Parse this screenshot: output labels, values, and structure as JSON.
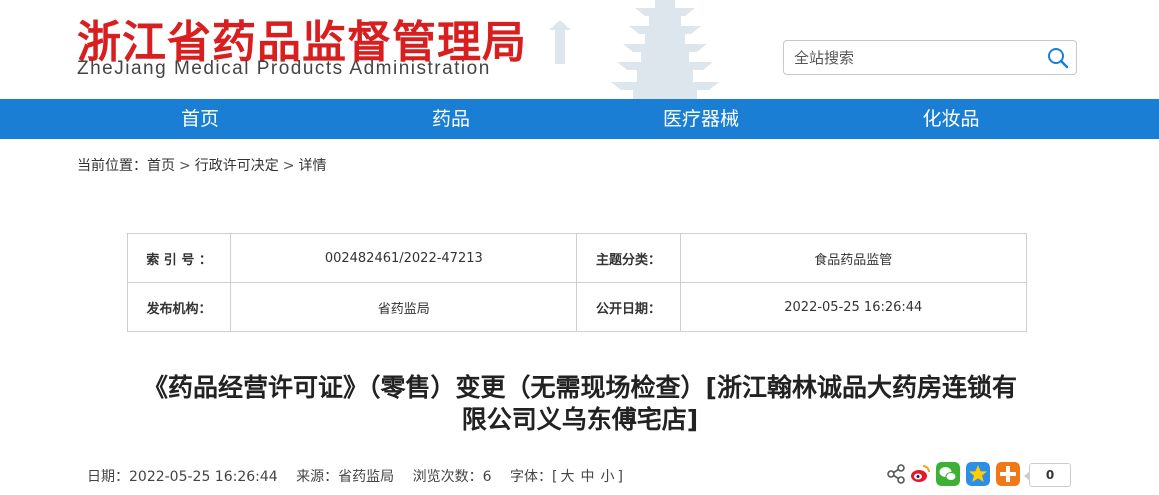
{
  "header": {
    "logo_cn": "浙江省药品监督管理局",
    "logo_en": "ZheJiang Medical Products Administration",
    "search": {
      "placeholder": "全站搜索",
      "icon": "search-icon"
    }
  },
  "nav": {
    "items": [
      {
        "label": "首页"
      },
      {
        "label": "药品"
      },
      {
        "label": "医疗器械"
      },
      {
        "label": "化妆品"
      }
    ],
    "color": "#1a7fd4"
  },
  "breadcrumb": {
    "prefix": "当前位置：",
    "items": [
      "首页",
      "行政许可决定",
      "详情"
    ],
    "separator": ">"
  },
  "info": {
    "index_label": "索 引 号 ：",
    "index_value": "002482461/2022-47213",
    "category_label": "主题分类：",
    "category_value": "食品药品监管",
    "publisher_label": "发布机构：",
    "publisher_value": "省药监局",
    "date_label": "公开日期：",
    "date_value": "2022-05-25 16:26:44"
  },
  "article": {
    "title_line1": "《药品经营许可证》（零售）变更（无需现场检查）[浙江翰林诚品大药房连锁有",
    "title_line2": "限公司义乌东傅宅店]"
  },
  "meta": {
    "date": "日期：2022-05-25 16:26:44",
    "source": "来源：省药监局",
    "views": "浏览次数：6",
    "font_label": "字体：[",
    "font_large": "大",
    "font_medium": "中",
    "font_small": "小",
    "font_close": "]"
  },
  "share": {
    "icons": [
      "share-icon",
      "weibo-icon",
      "wechat-icon",
      "qzone-icon",
      "more-share-icon"
    ],
    "count": "0"
  }
}
